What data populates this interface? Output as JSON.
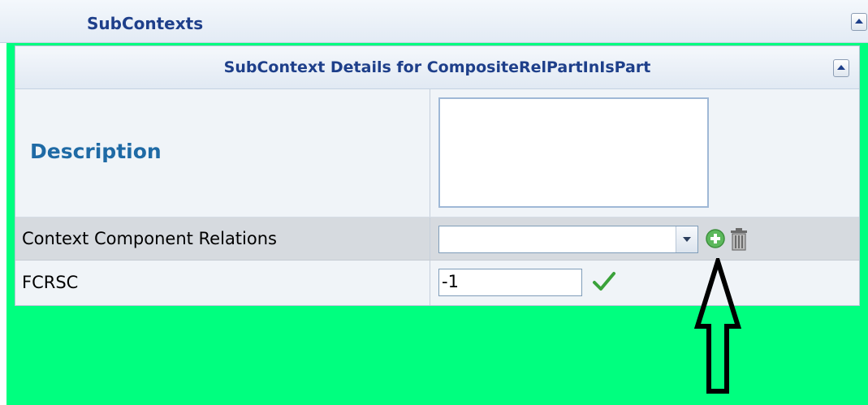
{
  "outer_section": {
    "title": "SubContexts"
  },
  "panel": {
    "title": "SubContext Details for CompositeRelPartInIsPart"
  },
  "rows": {
    "description": {
      "label": "Description",
      "value": ""
    },
    "context_component_relations": {
      "label": "Context Component Relations",
      "selected": ""
    },
    "fcrsc": {
      "label": "FCRSC",
      "value": "-1"
    }
  },
  "icons": {
    "outer_collapse": "chevron-up-icon",
    "panel_collapse": "chevron-up-icon",
    "add": "add-icon",
    "delete": "trash-icon",
    "confirm": "checkmark-icon",
    "annotation": "up-arrow-icon"
  },
  "colors": {
    "background_highlight": "#00ff7f",
    "title_text": "#1e3f8a",
    "description_label": "#1f6aa5",
    "add_icon": "#5cb85c",
    "check_icon": "#3aa23a"
  }
}
